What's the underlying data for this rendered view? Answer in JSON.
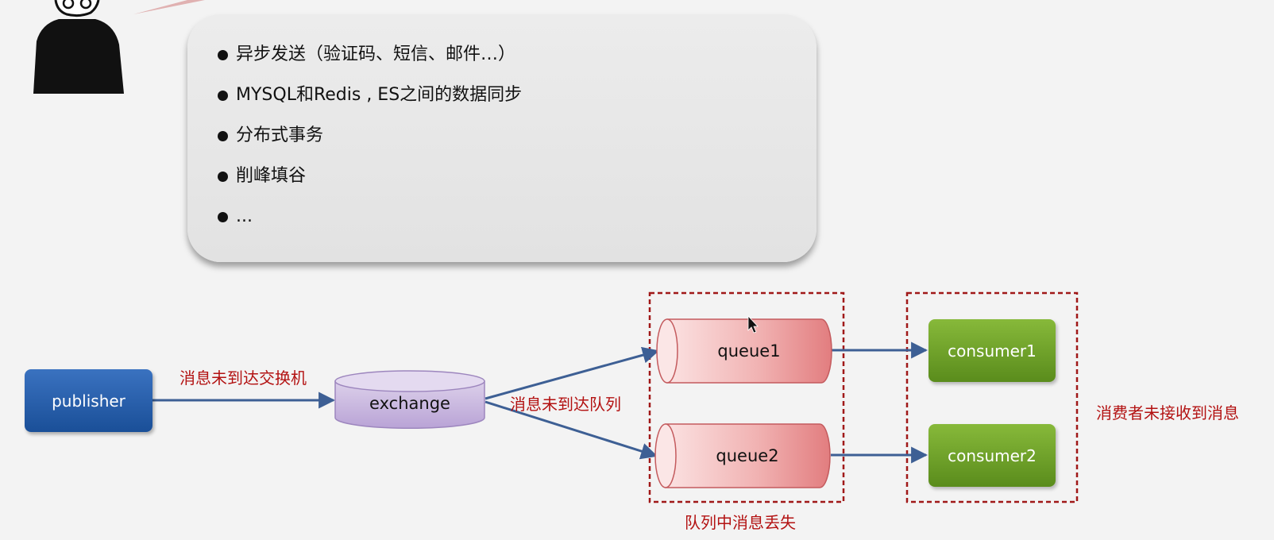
{
  "bubble": {
    "items": [
      "异步发送（验证码、短信、邮件…）",
      "MYSQL和Redis , ES之间的数据同步",
      "分布式事务",
      "削峰填谷",
      "..."
    ]
  },
  "diagram": {
    "publisher": "publisher",
    "exchange": "exchange",
    "queues": [
      "queue1",
      "queue2"
    ],
    "consumers": [
      "consumer1",
      "consumer2"
    ],
    "labels": {
      "to_exchange": "消息未到达交换机",
      "to_queue": "消息未到达队列",
      "queue_lost": "队列中消息丢失",
      "consumer_not_received": "消费者未接收到消息"
    },
    "colors": {
      "publisher": "#1f569f",
      "exchange": "#c9b5df",
      "queue": "#e7898a",
      "consumer": "#6a9c27",
      "arrow": "#3d5f94",
      "warning": "#b31212"
    }
  }
}
